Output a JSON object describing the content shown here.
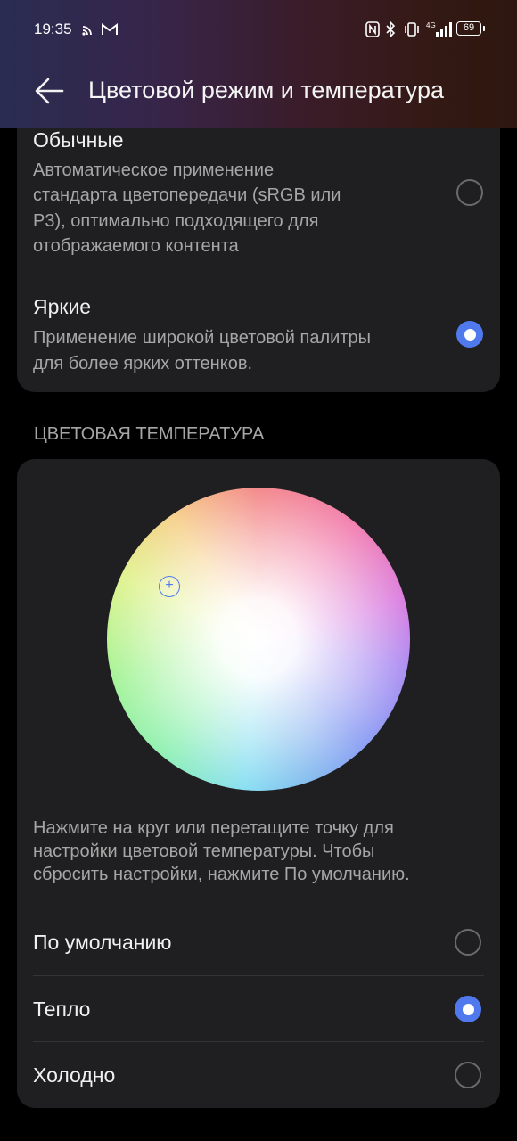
{
  "status_bar": {
    "time": "19:35",
    "battery": "69",
    "network": "4G"
  },
  "header": {
    "title": "Цветовой режим и температура",
    "back_icon": "arrow-left-icon"
  },
  "color_mode": {
    "options": [
      {
        "title": "Обычные",
        "description": [
          "Автоматическое применение",
          "стандарта цветопередачи (sRGB или",
          "P3), оптимально подходящего для",
          "отображаемого контента"
        ],
        "selected": false
      },
      {
        "title": "Яркие",
        "description": [
          "Применение широкой цветовой палитры",
          "для более ярких оттенков."
        ],
        "selected": true
      }
    ]
  },
  "color_temperature": {
    "section_label": "ЦВЕТОВАЯ ТЕМПЕРАТУРА",
    "hint": [
      "Нажмите на круг или перетащите точку для",
      "настройки цветовой температуры. Чтобы",
      "сбросить настройки, нажмите По умолчанию."
    ],
    "options": [
      {
        "label": "По умолчанию",
        "selected": false
      },
      {
        "label": "Тепло",
        "selected": true
      },
      {
        "label": "Холодно",
        "selected": false
      }
    ]
  },
  "colors": {
    "accent": "#4f79ed",
    "card": "#1f1f21",
    "background": "#000000"
  }
}
